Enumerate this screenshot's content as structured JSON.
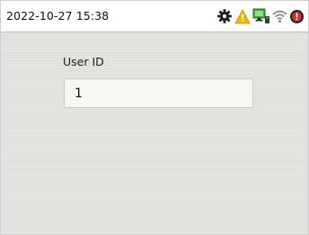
{
  "status_bar": {
    "datetime": "2022-10-27 15:38",
    "icons": [
      "settings-gear-icon",
      "warning-icon",
      "network-monitor-icon",
      "wifi-icon",
      "alarm-icon"
    ],
    "colors": {
      "warning": "#f2b705",
      "network": "#3fa83f",
      "alarm": "#d32f2f",
      "gear": "#222222",
      "wifi": "#8c8c8c"
    }
  },
  "form": {
    "user_id_label": "User ID",
    "user_id_value": "1"
  }
}
